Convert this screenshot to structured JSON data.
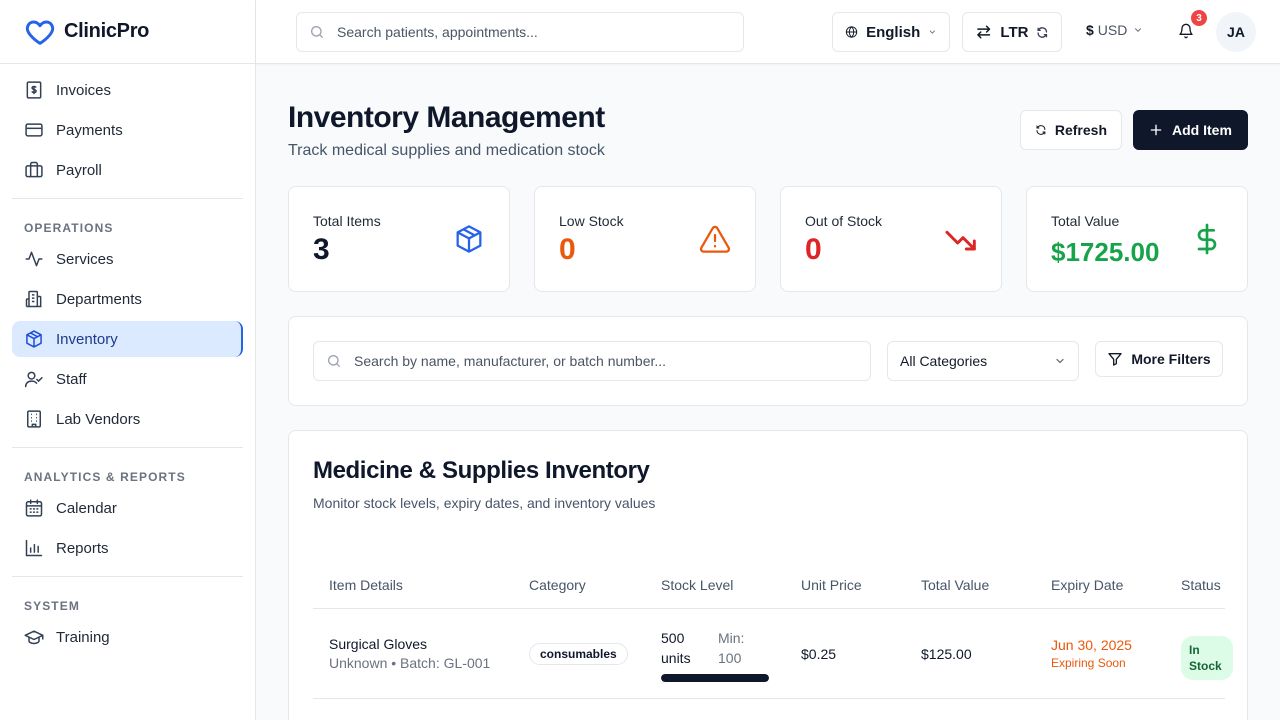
{
  "brand": {
    "name": "ClinicPro"
  },
  "sidebar": {
    "top_items": [
      {
        "label": "Invoices",
        "icon": "invoice-icon"
      },
      {
        "label": "Payments",
        "icon": "credit-card-icon"
      },
      {
        "label": "Payroll",
        "icon": "briefcase-icon"
      }
    ],
    "sections": [
      {
        "heading": "OPERATIONS",
        "items": [
          {
            "label": "Services",
            "icon": "activity-icon"
          },
          {
            "label": "Departments",
            "icon": "building-icon"
          },
          {
            "label": "Inventory",
            "icon": "package-icon",
            "active": true
          },
          {
            "label": "Staff",
            "icon": "user-check-icon"
          },
          {
            "label": "Lab Vendors",
            "icon": "office-building-icon"
          }
        ]
      },
      {
        "heading": "ANALYTICS & REPORTS",
        "items": [
          {
            "label": "Calendar",
            "icon": "calendar-icon"
          },
          {
            "label": "Reports",
            "icon": "bar-chart-icon"
          }
        ]
      },
      {
        "heading": "SYSTEM",
        "items": [
          {
            "label": "Training",
            "icon": "graduation-cap-icon"
          }
        ]
      }
    ]
  },
  "topbar": {
    "search_placeholder": "Search patients, appointments...",
    "language": "English",
    "direction": "LTR",
    "currency_symbol": "$",
    "currency_code": "USD",
    "notification_count": "3",
    "avatar_initials": "JA"
  },
  "page": {
    "title": "Inventory Management",
    "subtitle": "Track medical supplies and medication stock",
    "refresh_label": "Refresh",
    "add_label": "Add Item"
  },
  "stats": [
    {
      "label": "Total Items",
      "value": "3",
      "color": "#0f172a",
      "icon": "package-icon",
      "icon_color": "#2563eb"
    },
    {
      "label": "Low Stock",
      "value": "0",
      "color": "#ea580c",
      "icon": "alert-triangle-icon",
      "icon_color": "#ea580c"
    },
    {
      "label": "Out of Stock",
      "value": "0",
      "color": "#dc2626",
      "icon": "trending-down-icon",
      "icon_color": "#dc2626"
    },
    {
      "label": "Total Value",
      "value": "$1725.00",
      "color": "#16a34a",
      "icon": "dollar-icon",
      "icon_color": "#16a34a"
    }
  ],
  "filters": {
    "search_placeholder": "Search by name, manufacturer, or batch number...",
    "category_selected": "All Categories",
    "more_filters_label": "More Filters"
  },
  "table": {
    "title": "Medicine & Supplies Inventory",
    "subtitle": "Monitor stock levels, expiry dates, and inventory values",
    "columns": [
      "Item Details",
      "Category",
      "Stock Level",
      "Unit Price",
      "Total Value",
      "Expiry Date",
      "Status"
    ],
    "rows": [
      {
        "name": "Surgical Gloves",
        "meta": "Unknown • Batch: GL-001",
        "category": "consumables",
        "stock_qty": "500",
        "stock_unit": "units",
        "min_label": "Min:",
        "min_qty": "100",
        "stock_level_fraction": 1.0,
        "unit_price": "$0.25",
        "total_value": "$125.00",
        "expiry_date": "Jun 30, 2025",
        "expiry_note": "Expiring Soon",
        "status": "In Stock"
      }
    ]
  },
  "colors": {
    "brand_blue": "#2563eb",
    "active_nav_bg": "#dbeafe",
    "dark_button": "#0f172a",
    "expiry_warning": "#ea580c",
    "in_stock_bg": "#dcfce7",
    "badge_red": "#ef4444"
  }
}
